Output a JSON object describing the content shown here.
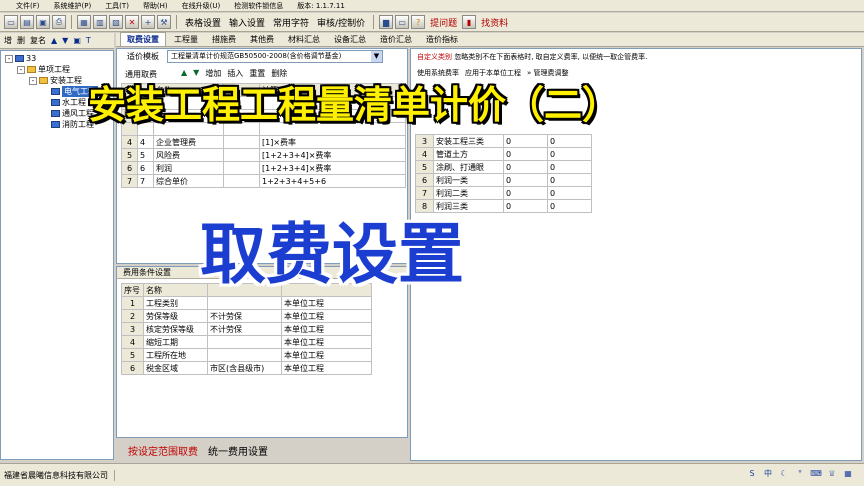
{
  "menubar": {
    "items": [
      "文件(F)",
      "系统维护(P)",
      "工具(T)",
      "帮助(H)",
      "在线升级(U)",
      "检测软件锁信息",
      "版本: 1.1.7.11"
    ]
  },
  "toolbar": {
    "icons": [
      "new-file",
      "open-folder",
      "save",
      "print",
      "grid",
      "calc",
      "report",
      "delete",
      "add",
      "hammer"
    ],
    "text_buttons": [
      "表格设置",
      "输入设置",
      "常用字符",
      "审核/控制价"
    ],
    "ask_label": "提问题",
    "find_label": "找资料"
  },
  "lefttool": {
    "items": [
      "增",
      "删",
      "复名"
    ]
  },
  "tree": {
    "root": "33",
    "project": "单项工程",
    "subproject": "安装工程",
    "items": [
      "电气工程",
      "水工程",
      "通风工程",
      "消防工程"
    ]
  },
  "tabs": [
    "取费设置",
    "工程量",
    "措施费",
    "其他费",
    "材料汇总",
    "设备汇总",
    "造价汇总",
    "造价指标"
  ],
  "fee_panel": {
    "template_label": "适价模板",
    "template_value": "工程量清单计价规范GB50500-2008(含价格调节基金)",
    "general_label": "通用取费",
    "actions": [
      "增加",
      "插入",
      "重置",
      "删除"
    ],
    "visible_headers": [
      "序号",
      "名称",
      "计算式"
    ],
    "rows": [
      {
        "idx": "4",
        "code": "4",
        "name": "企业管理费",
        "formula": "[1]×费率"
      },
      {
        "idx": "5",
        "code": "5",
        "name": "风险费",
        "formula": "[1+2+3+4]×费率"
      },
      {
        "idx": "6",
        "code": "6",
        "name": "利润",
        "formula": "[1+2+3+4]×费率"
      },
      {
        "idx": "7",
        "code": "7",
        "name": "综合单价",
        "formula": "1+2+3+4+5+6"
      }
    ]
  },
  "condition_panel": {
    "title": "费用条件设置",
    "headers": [
      "序号",
      "名称",
      "",
      ""
    ],
    "rows": [
      {
        "idx": "1",
        "name": "工程类别",
        "value": "",
        "scope": "本单位工程"
      },
      {
        "idx": "2",
        "name": "劳保等级",
        "value": "不计劳保",
        "scope": "本单位工程"
      },
      {
        "idx": "3",
        "name": "核定劳保等级",
        "value": "不计劳保",
        "scope": "本单位工程"
      },
      {
        "idx": "4",
        "name": "缩短工期",
        "value": "",
        "scope": "本单位工程"
      },
      {
        "idx": "5",
        "name": "工程所在地",
        "value": "",
        "scope": "本单位工程"
      },
      {
        "idx": "6",
        "name": "税金区域",
        "value": "市区(含县级市)",
        "scope": "本单位工程"
      }
    ]
  },
  "custom_panel": {
    "label": "自定义类别",
    "note": "忽略类别不在下面表格时, 取自定义费率, 以便统一取企管费率.",
    "system_label": "使用系统费率",
    "apply_label": "应用于本单位工程",
    "adjust_label": "» 管理费调整",
    "rows": [
      {
        "idx": "3",
        "name": "安装工程三类",
        "a": "0",
        "b": "0"
      },
      {
        "idx": "4",
        "name": "管道土方",
        "a": "0",
        "b": "0"
      },
      {
        "idx": "5",
        "name": "涂刷、打通眼",
        "a": "0",
        "b": "0"
      },
      {
        "idx": "6",
        "name": "利润一类",
        "a": "0",
        "b": "0"
      },
      {
        "idx": "7",
        "name": "利润二类",
        "a": "0",
        "b": "0"
      },
      {
        "idx": "8",
        "name": "利润三类",
        "a": "0",
        "b": "0"
      }
    ]
  },
  "bottom_actions": {
    "range_label": "按设定范围取费",
    "unify_label": "统一费用设置"
  },
  "status": {
    "company": "福建省晨曦信息科技有限公司"
  },
  "overlay": {
    "title": "安装工程工程量清单计价（二）",
    "subtitle": "取费设置"
  }
}
